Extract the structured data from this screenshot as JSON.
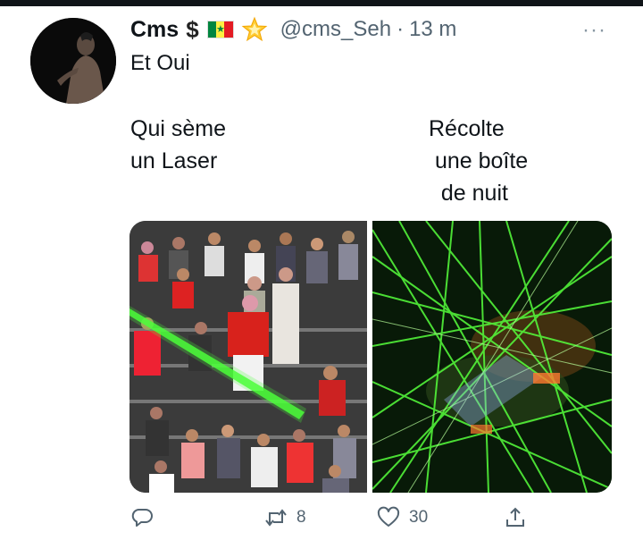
{
  "author": {
    "name": "Cms",
    "dollar": "$",
    "handle": "@cms_Seh",
    "separator": "·",
    "time": "13 m",
    "badges": [
      "senegal-flag-icon",
      "glowing-star-icon"
    ],
    "avatar": "avatar-image"
  },
  "more_label": "···",
  "tweet": {
    "text": "Et Oui",
    "caption_left": "Qui sème\nun Laser",
    "caption_right": "Récolte\n une boîte\n  de nuit"
  },
  "media": [
    {
      "kind": "photo",
      "subject": "stadium crowd with green laser beam"
    },
    {
      "kind": "photo",
      "subject": "green laser light show"
    }
  ],
  "actions": {
    "reply": {
      "icon": "reply-icon",
      "count": ""
    },
    "retweet": {
      "icon": "retweet-icon",
      "count": "8"
    },
    "like": {
      "icon": "like-icon",
      "count": "30"
    },
    "share": {
      "icon": "share-icon",
      "count": ""
    }
  },
  "colors": {
    "text_primary": "#0f1419",
    "text_secondary": "#536471",
    "laser_green": "#4cff3a"
  }
}
